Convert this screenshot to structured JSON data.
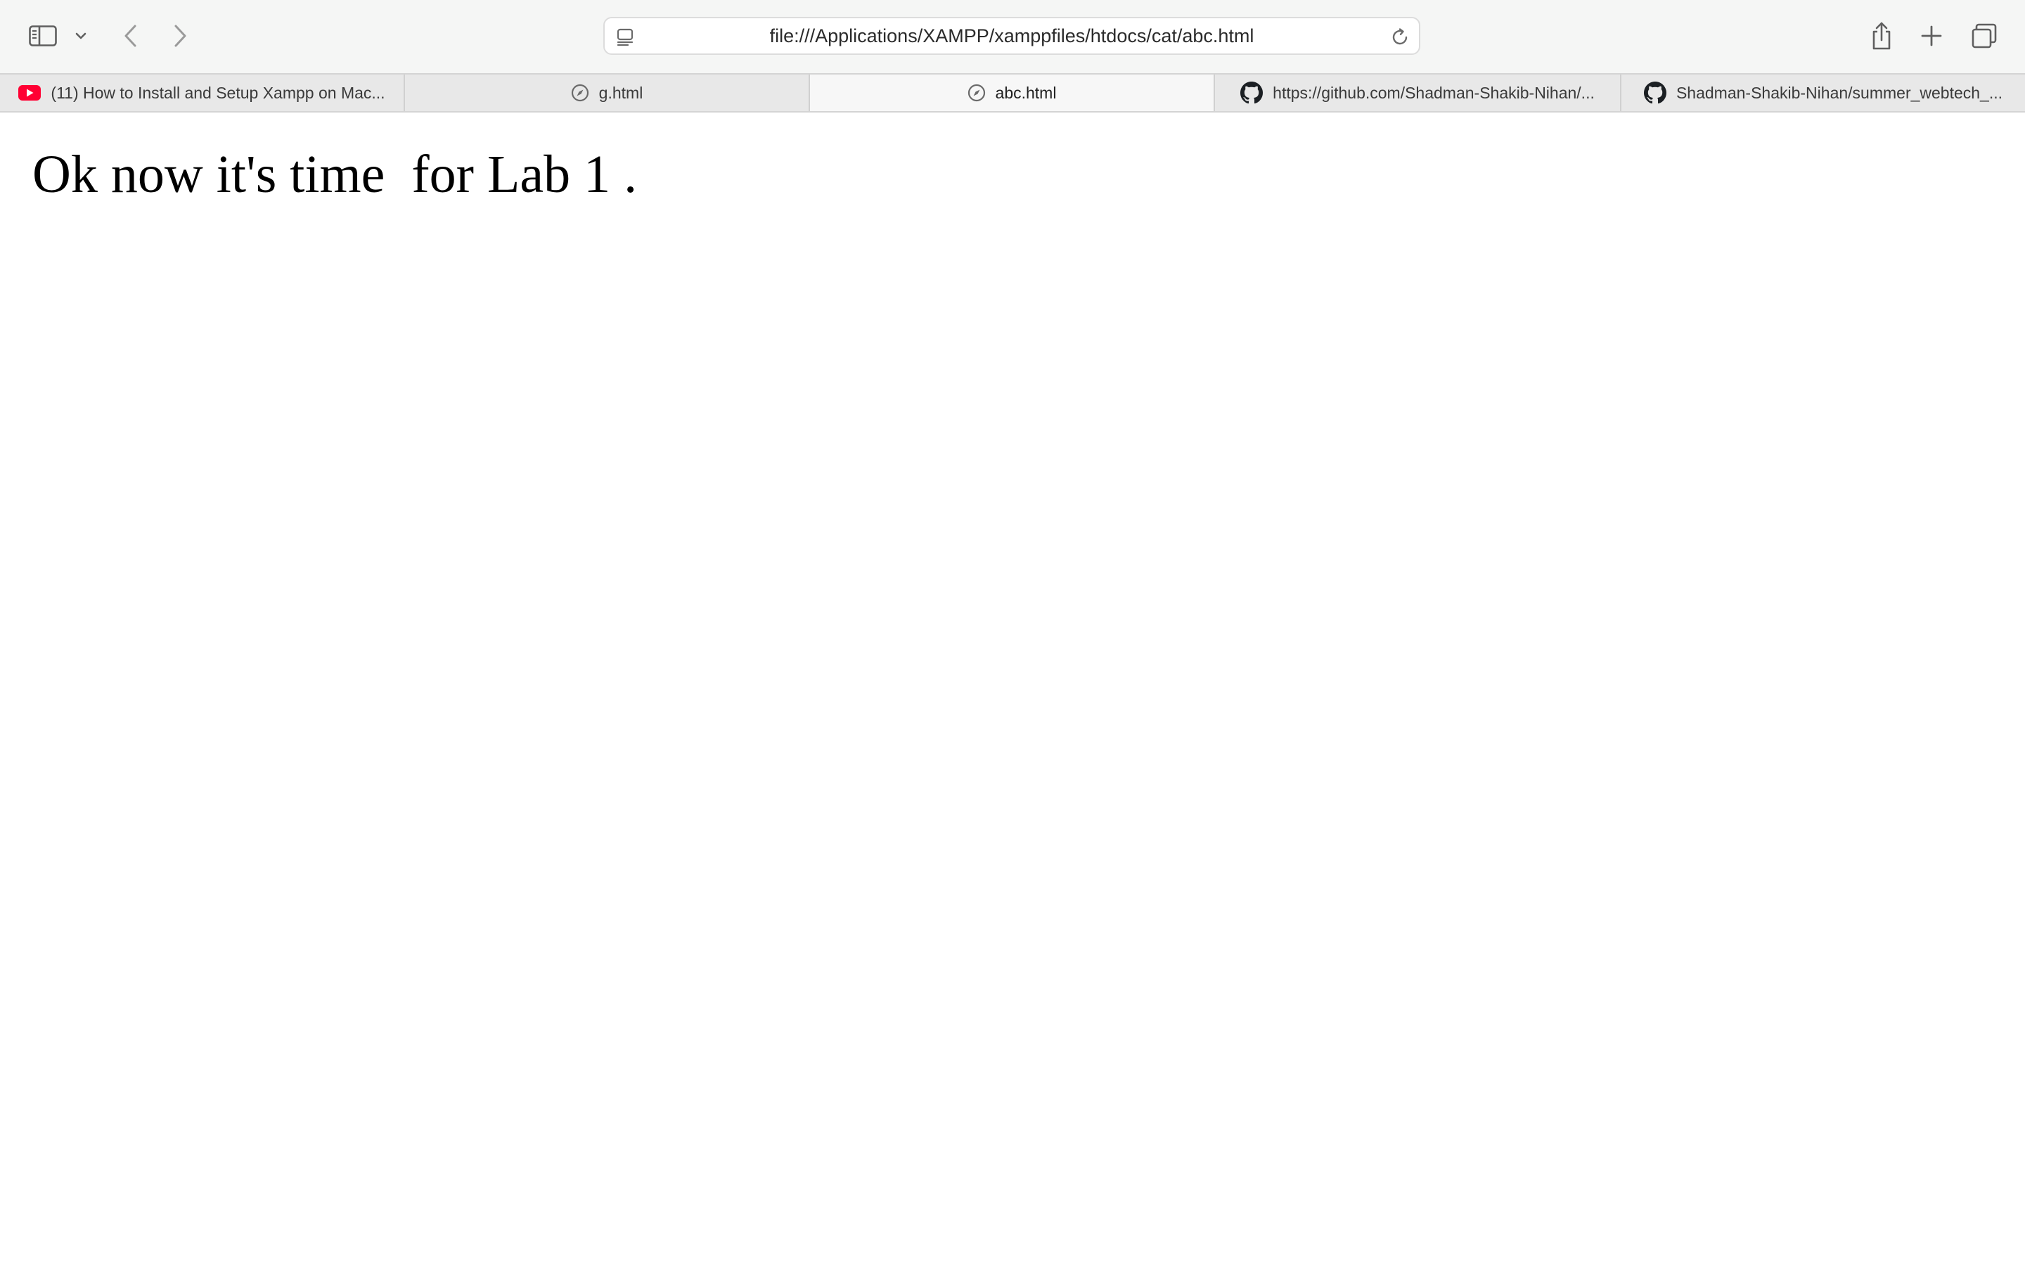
{
  "browser": {
    "address_bar": {
      "url": "file:///Applications/XAMPP/xamppfiles/htdocs/cat/abc.html"
    },
    "tabs": [
      {
        "label": "(11) How to Install and Setup Xampp on Mac...",
        "icon": "youtube-icon",
        "active": false
      },
      {
        "label": "g.html",
        "icon": "compass-icon",
        "active": false
      },
      {
        "label": "abc.html",
        "icon": "compass-icon",
        "active": true
      },
      {
        "label": "https://github.com/Shadman-Shakib-Nihan/...",
        "icon": "github-icon",
        "active": false
      },
      {
        "label": "Shadman-Shakib-Nihan/summer_webtech_...",
        "icon": "github-icon",
        "active": false
      }
    ],
    "toolbar_icons": [
      "sidebar-icon",
      "chevron-down-icon",
      "back-arrow-icon",
      "forward-arrow-icon",
      "share-icon",
      "plus-icon",
      "tab-overview-icon",
      "reload-icon",
      "page-menu-icon"
    ]
  },
  "page": {
    "heading": "Ok now it's time  for Lab 1 ."
  },
  "colors": {
    "toolbar_bg": "#f5f6f5",
    "tabbar_bg": "#e8e8e8",
    "active_tab_bg": "#f7f7f7",
    "youtube_red": "#ff0000",
    "text": "#000000"
  }
}
